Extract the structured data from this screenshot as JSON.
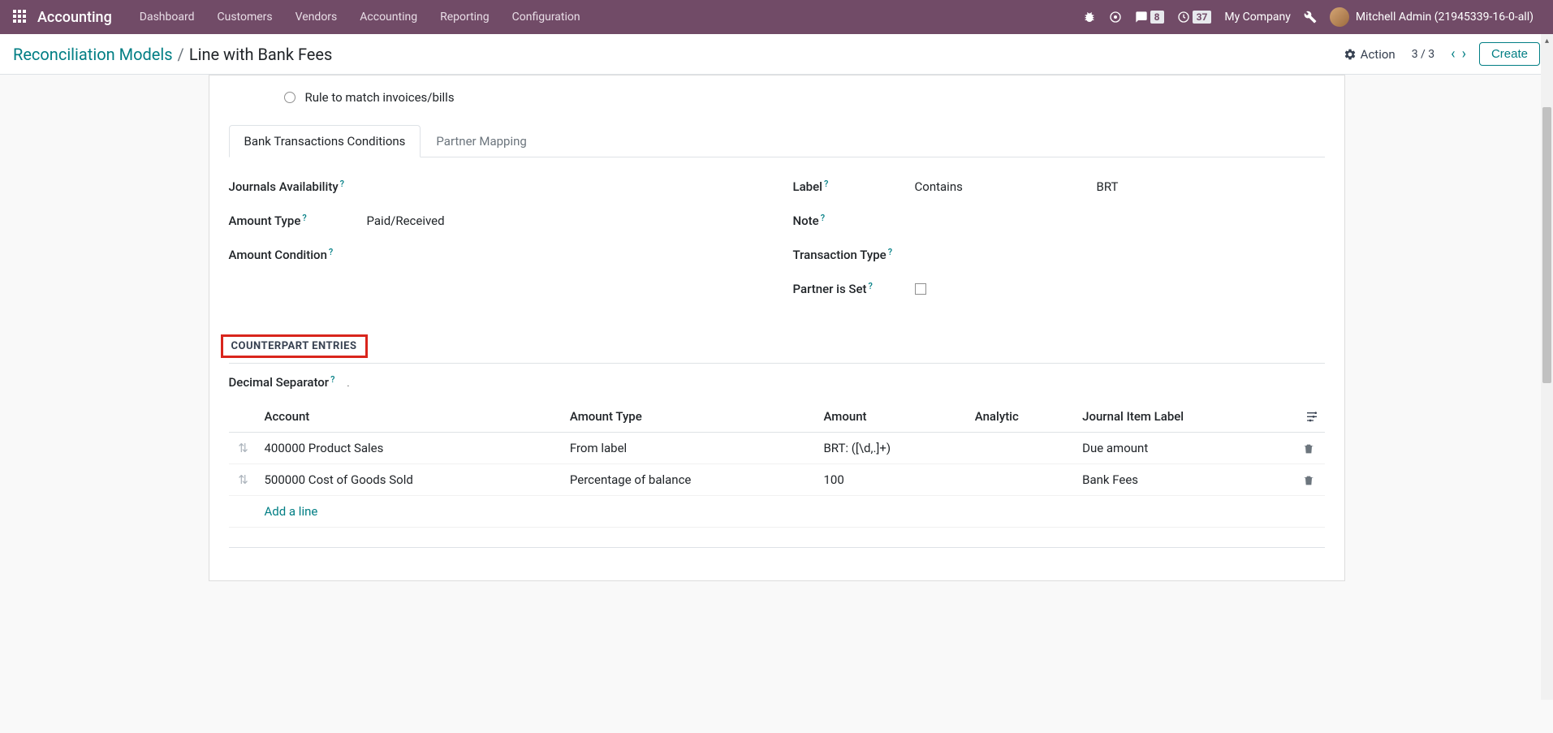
{
  "nav": {
    "brand": "Accounting",
    "items": [
      "Dashboard",
      "Customers",
      "Vendors",
      "Accounting",
      "Reporting",
      "Configuration"
    ],
    "msg_badge": "8",
    "clock_badge": "37",
    "company": "My Company",
    "user": "Mitchell Admin (21945339-16-0-all)"
  },
  "breadcrumb": {
    "parent": "Reconciliation Models",
    "current": "Line with Bank Fees",
    "action_label": "Action",
    "pager": "3 / 3",
    "create": "Create"
  },
  "radios": {
    "rule2": "Rule to match invoices/bills"
  },
  "tabs": [
    "Bank Transactions Conditions",
    "Partner Mapping"
  ],
  "form_left": {
    "journals": "Journals Availability",
    "amount_type": "Amount Type",
    "amount_type_val": "Paid/Received",
    "amount_condition": "Amount Condition"
  },
  "form_right": {
    "label": "Label",
    "label_op": "Contains",
    "label_val": "BRT",
    "note": "Note",
    "tx_type": "Transaction Type",
    "partner_set": "Partner is Set"
  },
  "section": "COUNTERPART ENTRIES",
  "decimal_sep": "Decimal Separator",
  "decimal_sep_val": ".",
  "table": {
    "headers": [
      "Account",
      "Amount Type",
      "Amount",
      "Analytic",
      "Journal Item Label"
    ],
    "rows": [
      {
        "account": "400000 Product Sales",
        "amount_type": "From label",
        "amount": "BRT: ([\\d,.]+)",
        "analytic": "",
        "jlabel": "Due amount"
      },
      {
        "account": "500000 Cost of Goods Sold",
        "amount_type": "Percentage of balance",
        "amount": "100",
        "analytic": "",
        "jlabel": "Bank Fees"
      }
    ],
    "add_line": "Add a line"
  }
}
